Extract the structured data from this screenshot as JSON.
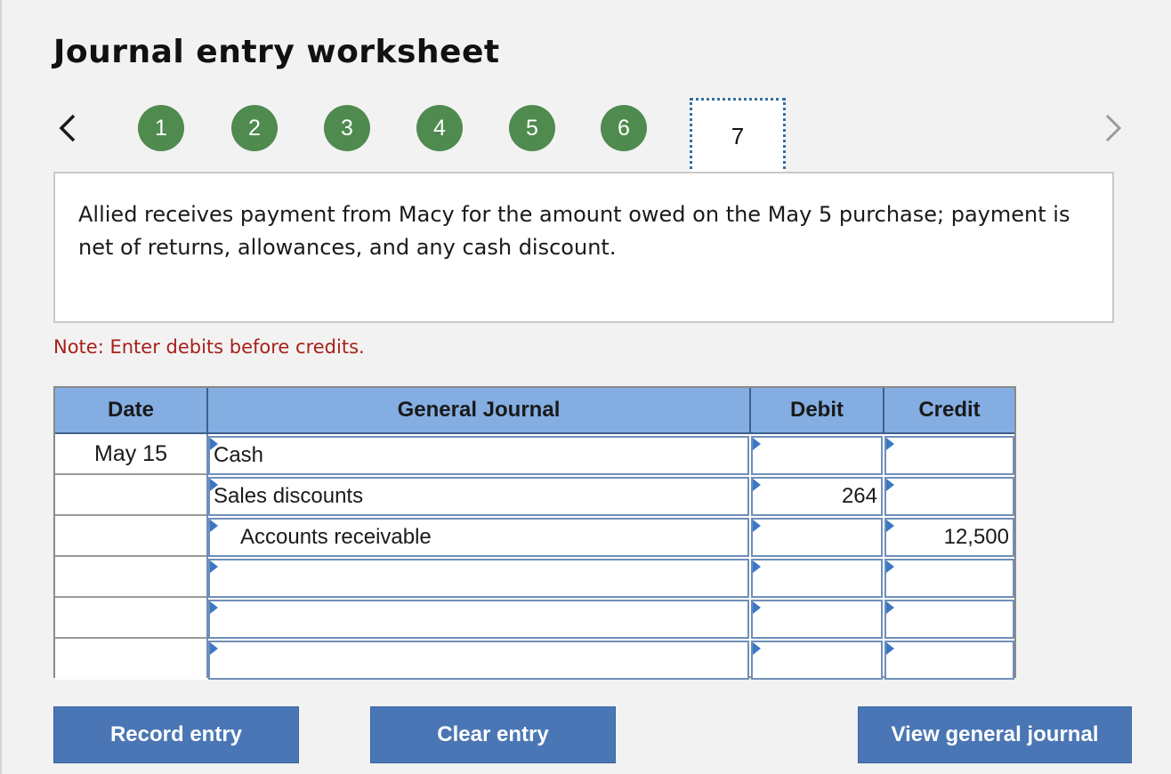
{
  "title": "Journal entry worksheet",
  "steps": [
    "1",
    "2",
    "3",
    "4",
    "5",
    "6"
  ],
  "current_step": "7",
  "prompt": "Allied receives payment from Macy for the amount owed on the May 5 purchase; payment is net of returns, allowances, and any cash discount.",
  "note": "Note: Enter debits before credits.",
  "journal": {
    "headers": {
      "date": "Date",
      "account": "General Journal",
      "debit": "Debit",
      "credit": "Credit"
    },
    "rows": [
      {
        "date": "May 15",
        "account": "Cash",
        "debit": "",
        "credit": ""
      },
      {
        "date": "",
        "account": "Sales discounts",
        "debit": "264",
        "credit": ""
      },
      {
        "date": "",
        "account": "Accounts receivable",
        "debit": "",
        "credit": "12,500"
      },
      {
        "date": "",
        "account": "",
        "debit": "",
        "credit": ""
      },
      {
        "date": "",
        "account": "",
        "debit": "",
        "credit": ""
      },
      {
        "date": "",
        "account": "",
        "debit": "",
        "credit": ""
      }
    ]
  },
  "buttons": {
    "record": "Record entry",
    "clear": "Clear entry",
    "view": "View general journal"
  },
  "colors": {
    "step_complete": "#4f8a4e",
    "header_bg": "#84aee2",
    "button_bg": "#4a76b5",
    "note_text": "#a8201a"
  }
}
